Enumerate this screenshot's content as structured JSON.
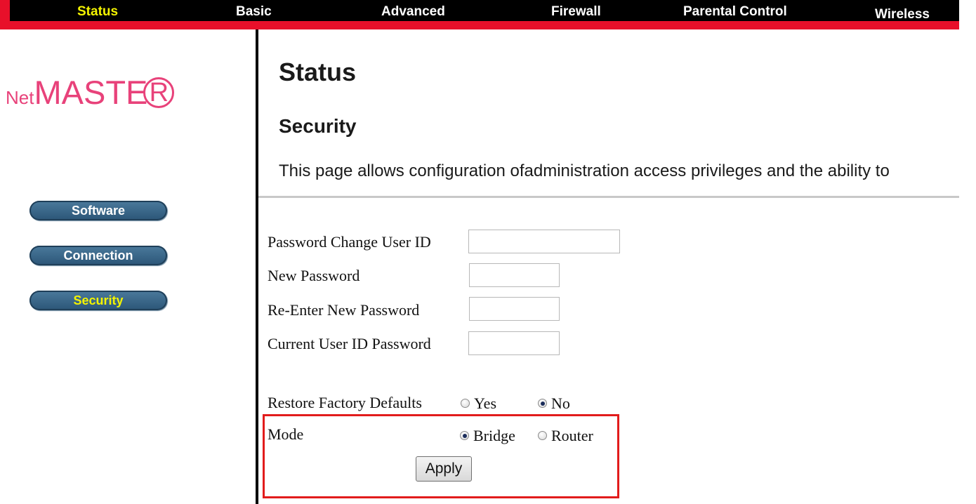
{
  "top_nav": {
    "items": [
      {
        "label": "Status",
        "active": true
      },
      {
        "label": "Basic",
        "active": false
      },
      {
        "label": "Advanced",
        "active": false
      },
      {
        "label": "Firewall",
        "active": false
      },
      {
        "label": "Parental Control",
        "active": false
      },
      {
        "label": "Wireless",
        "active": false
      }
    ]
  },
  "logo": {
    "net": "Net",
    "master": "MASTE",
    "r": "R"
  },
  "sidebar": {
    "items": [
      {
        "label": "Software",
        "active": false
      },
      {
        "label": "Connection",
        "active": false
      },
      {
        "label": "Security",
        "active": true
      }
    ]
  },
  "main": {
    "title": "Status",
    "subtitle": "Security",
    "description": "This page allows configuration ofadministration access privileges and the ability to"
  },
  "form": {
    "password_change_user_id_label": "Password Change User ID",
    "new_password_label": "New Password",
    "reenter_password_label": "Re-Enter New Password",
    "current_password_label": "Current User ID Password",
    "restore_defaults_label": "Restore Factory Defaults",
    "restore_yes_label": "Yes",
    "restore_no_label": "No",
    "restore_selected": "No",
    "mode_label": "Mode",
    "mode_bridge_label": "Bridge",
    "mode_router_label": "Router",
    "mode_selected": "Bridge",
    "apply_label": "Apply"
  },
  "colors": {
    "accent_red": "#e8102a",
    "active_yellow": "#f4f400",
    "logo_pink": "#e8427a",
    "sidebar_button_blue": "#2b5577",
    "highlight_box_red": "#e21c1c"
  }
}
